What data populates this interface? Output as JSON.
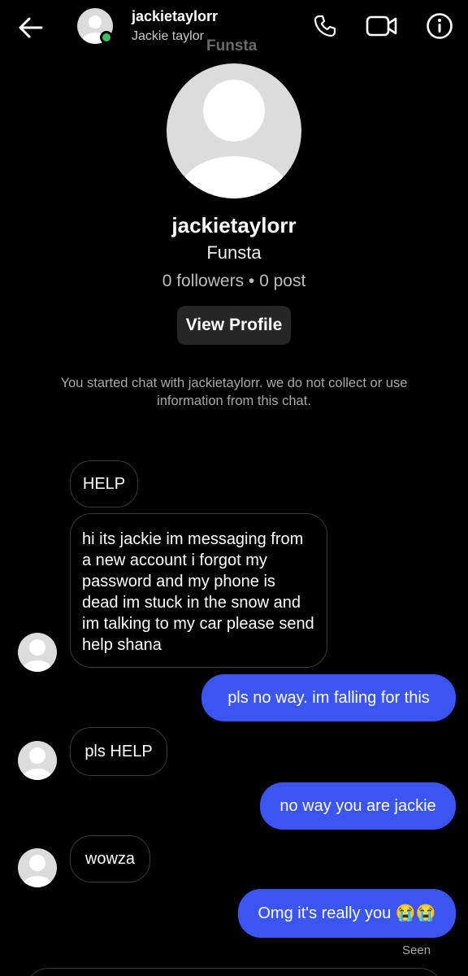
{
  "header": {
    "username": "jackietaylorr",
    "display_name": "Jackie taylor",
    "overlay_text": "Funsta",
    "icons": [
      "back-arrow-icon",
      "phone-icon",
      "video-icon",
      "info-icon"
    ],
    "online_color": "#3ec15f"
  },
  "profile": {
    "username": "jackietaylorr",
    "subtitle": "Funsta",
    "stats": "0 followers • 0 post",
    "button_label": "View Profile"
  },
  "notice": "You started chat with jackietaylorr. we do not collect or use information from this chat.",
  "messages": [
    {
      "sender": "them",
      "text": "HELP"
    },
    {
      "sender": "them",
      "text": "hi its jackie im messaging from a new account i forgot my password and my phone is dead im stuck in the snow and im talking to my car please send help shana"
    },
    {
      "sender": "me",
      "text": "pls no way. im falling for this"
    },
    {
      "sender": "them",
      "text": "pls HELP"
    },
    {
      "sender": "me",
      "text": "no way you are jackie"
    },
    {
      "sender": "them",
      "text": "wowza"
    },
    {
      "sender": "me",
      "text": "Omg it's really you 😭😭"
    }
  ],
  "seen_label": "Seen",
  "colors": {
    "sent_bubble": "#3a55f2",
    "background": "#000000"
  }
}
